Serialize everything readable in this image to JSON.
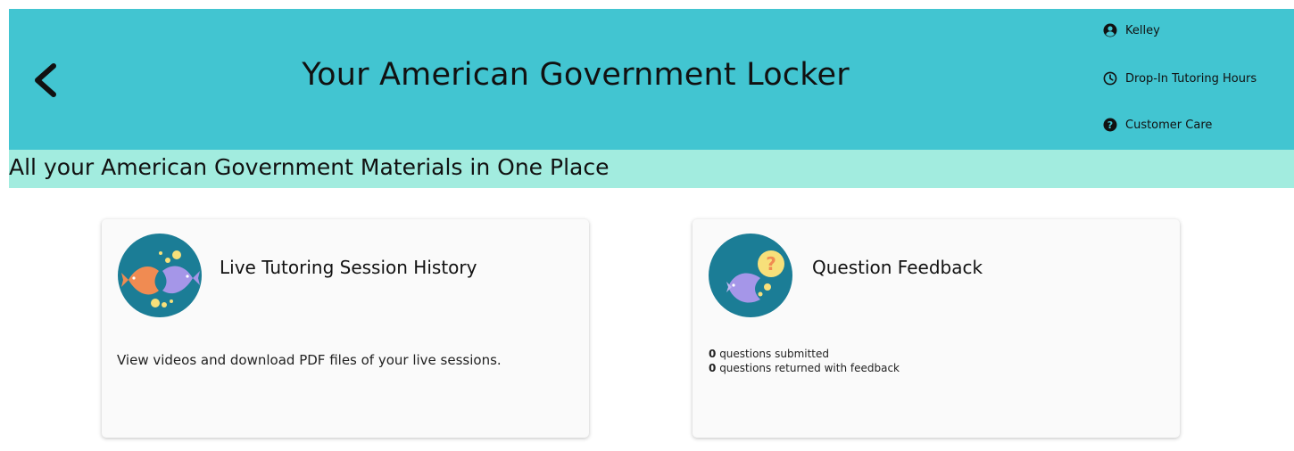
{
  "header": {
    "title": "Your American Government Locker",
    "background_color": "#42c5d1",
    "back_icon": "chevron-left-icon"
  },
  "user_menu": {
    "user_name": "Kelley",
    "user_icon": "user-circle-icon",
    "tutoring_hours_label": "Drop-In Tutoring Hours",
    "tutoring_hours_icon": "clock-icon",
    "customer_care_label": "Customer Care",
    "customer_care_icon": "question-circle-icon"
  },
  "subheader": {
    "title": "All your American Government Materials in One Place",
    "background_color": "#a2ecdf"
  },
  "cards": [
    {
      "title": "Live Tutoring Session History",
      "description": "View videos and download PDF files of your live sessions.",
      "icon": "two-fish-icon"
    },
    {
      "title": "Question Feedback",
      "icon": "fish-question-icon",
      "stats": [
        {
          "count": "0",
          "label": "questions submitted"
        },
        {
          "count": "0",
          "label": "questions returned with feedback"
        }
      ]
    }
  ]
}
